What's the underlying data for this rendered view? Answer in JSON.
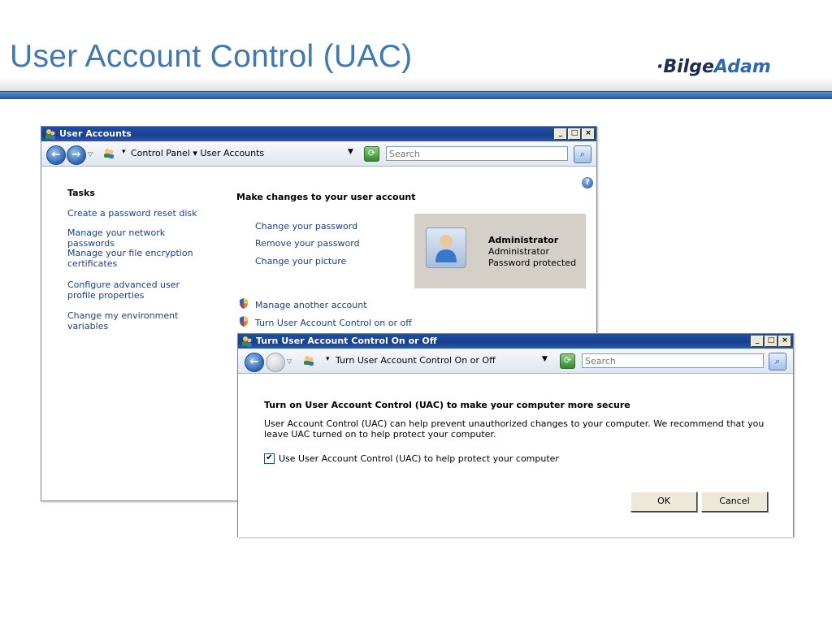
{
  "slide": {
    "title": "User Account Control (UAC)",
    "logo_part1": "·Bilge",
    "logo_part2": "Adam"
  },
  "window_main": {
    "title": "User Accounts",
    "controls": [
      "_",
      "□",
      "×"
    ],
    "breadcrumb": "Control Panel  ▾  User Accounts",
    "search_placeholder": "Search",
    "tasks_heading": "Tasks",
    "tasks": [
      "Create a password reset disk",
      "Manage your network passwords",
      "Manage your file encryption certificates",
      "Configure advanced user profile properties",
      "Change my environment variables"
    ],
    "main_heading": "Make changes to your user account",
    "links": [
      "Change your password",
      "Remove your password",
      "Change your picture"
    ],
    "shield_links": [
      "Manage another account",
      "Turn User Account Control on or off"
    ],
    "user": {
      "name": "Administrator",
      "role": "Administrator",
      "status": "Password protected"
    }
  },
  "window_uac": {
    "title": "Turn User Account Control On or Off",
    "controls": [
      "_",
      "□",
      "×"
    ],
    "breadcrumb": "Turn User Account Control On or Off",
    "search_placeholder": "Search",
    "heading": "Turn on User Account Control (UAC) to make your computer more secure",
    "description": "User Account Control (UAC) can help prevent unauthorized changes to your computer.  We recommend that you leave UAC turned on to help protect your computer.",
    "checkbox_label": "Use User Account Control (UAC) to help protect your computer",
    "checkbox_checked": true,
    "ok_label": "OK",
    "cancel_label": "Cancel"
  },
  "colors": {
    "title_blue": "#3f78b7",
    "titlebar_blue": "#1c4fa5",
    "link_blue": "#1a3f8f"
  }
}
